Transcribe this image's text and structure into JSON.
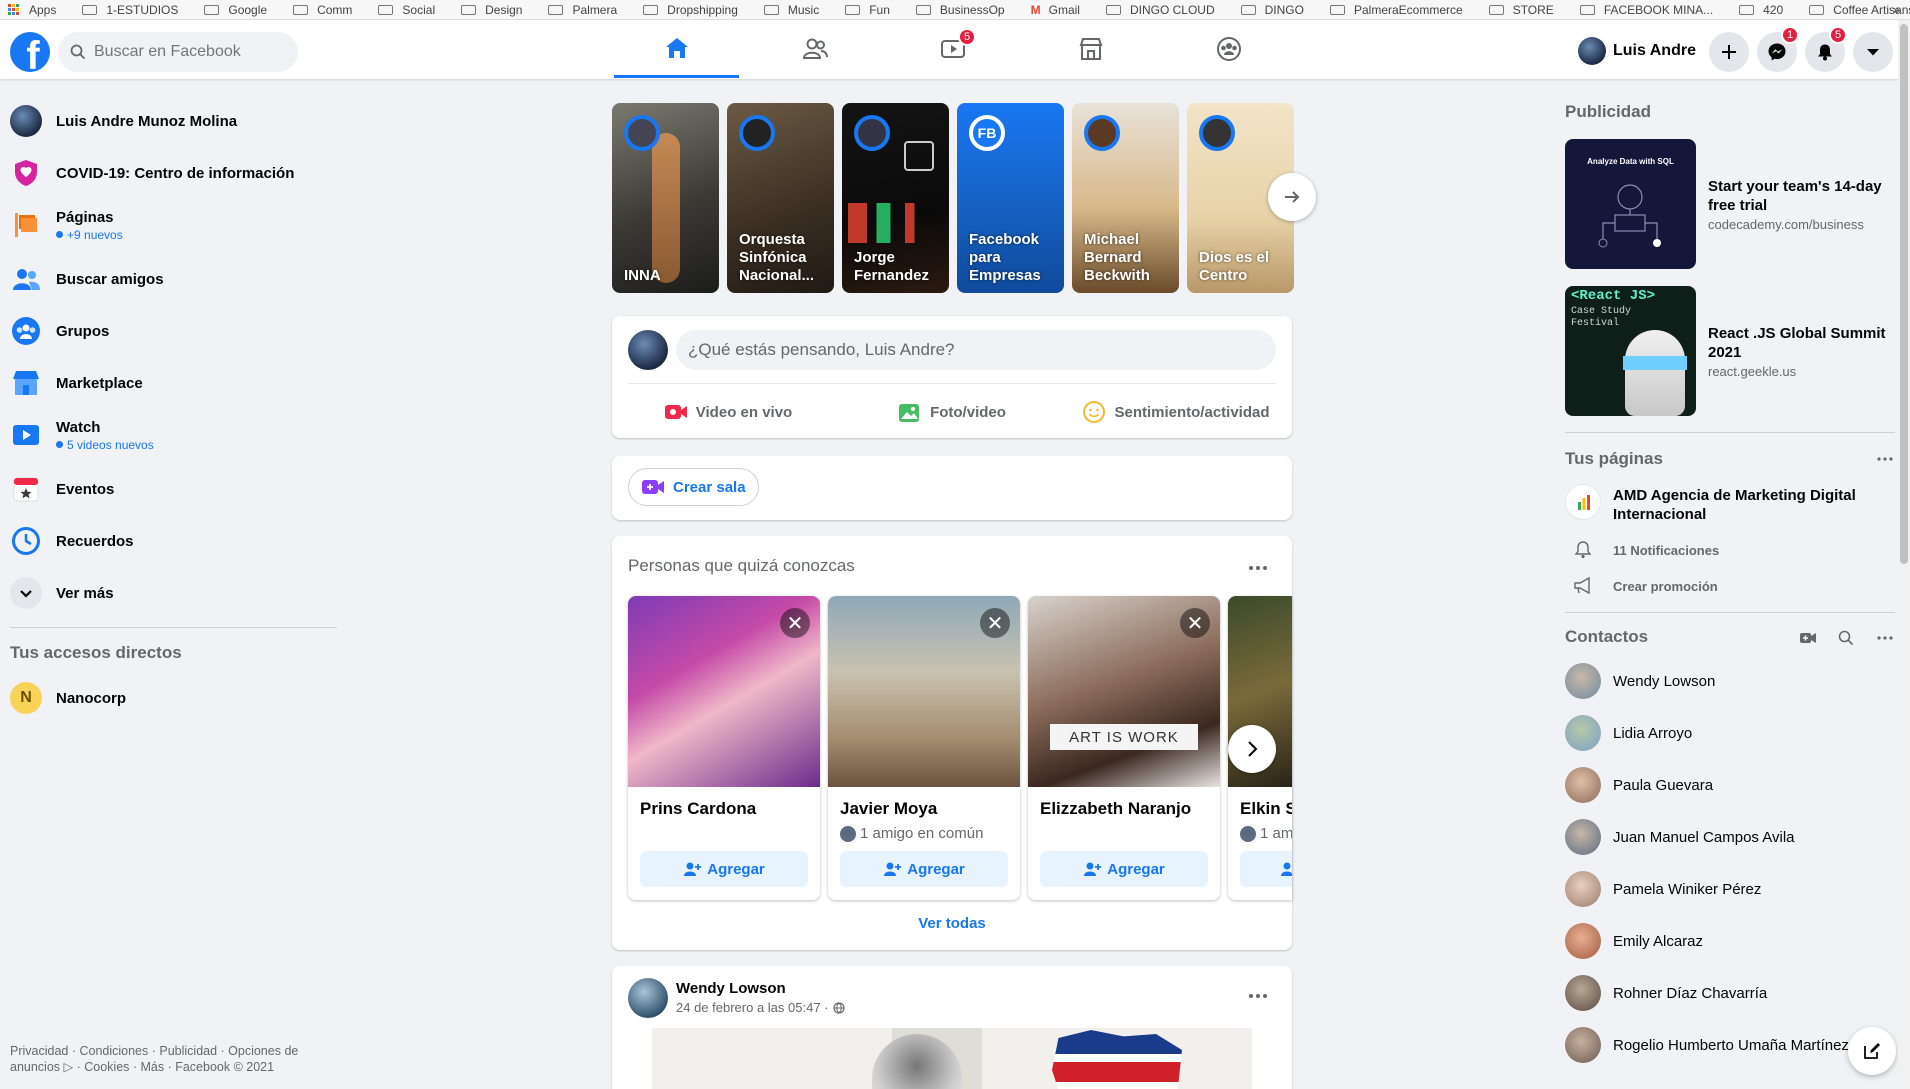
{
  "bookmarks": [
    "Apps",
    "1-ESTUDIOS",
    "Google",
    "Comm",
    "Social",
    "Design",
    "Palmera",
    "Dropshipping",
    "Music",
    "Fun",
    "BusinessOp",
    "Gmail",
    "DINGO CLOUD",
    "DINGO",
    "PalmeraEcommerce",
    "STORE",
    "FACEBOOK MINA...",
    "420",
    "Coffee Artisans"
  ],
  "bookmarks_more": "»",
  "search": {
    "placeholder": "Buscar en Facebook"
  },
  "nav": {
    "watch_badge": "5"
  },
  "profile": {
    "name": "Luis Andre"
  },
  "header_badges": {
    "messenger": "1",
    "notifications": "5"
  },
  "sidebar": {
    "items": [
      {
        "label": "Luis Andre Munoz Molina"
      },
      {
        "label": "COVID-19: Centro de información"
      },
      {
        "label": "Páginas",
        "sub": "+9 nuevos"
      },
      {
        "label": "Buscar amigos"
      },
      {
        "label": "Grupos"
      },
      {
        "label": "Marketplace"
      },
      {
        "label": "Watch",
        "sub": "5 videos nuevos"
      },
      {
        "label": "Eventos"
      },
      {
        "label": "Recuerdos"
      },
      {
        "label": "Ver más"
      }
    ],
    "shortcuts_title": "Tus accesos directos",
    "shortcut": {
      "letter": "N",
      "label": "Nanocorp"
    },
    "footer": "Privacidad · Condiciones · Publicidad · Opciones de anuncios ▷ · Cookies · Más · Facebook © 2021"
  },
  "stories": [
    {
      "name": "INNA",
      "avatar_text": ""
    },
    {
      "name": "Orquesta Sinfónica Nacional...",
      "avatar_text": ""
    },
    {
      "name": "Jorge Fernandez",
      "avatar_text": ""
    },
    {
      "name": "Facebook para Empresas",
      "avatar_text": "FB"
    },
    {
      "name": "Michael Bernard Beckwith",
      "avatar_text": ""
    },
    {
      "name": "Dios es el Centro",
      "avatar_text": ""
    }
  ],
  "composer": {
    "placeholder": "¿Qué estás pensando, Luis Andre?",
    "live": "Video en vivo",
    "photo": "Foto/video",
    "feeling": "Sentimiento/actividad"
  },
  "room": {
    "label": "Crear sala"
  },
  "pymk": {
    "title": "Personas que quizá conozcas",
    "people": [
      {
        "name": "Prins Cardona",
        "mutual": "",
        "add": "Agregar"
      },
      {
        "name": "Javier Moya",
        "mutual": "1 amigo en común",
        "add": "Agregar"
      },
      {
        "name": "Elizzabeth Naranjo",
        "mutual": "",
        "add": "Agregar",
        "overlay": "ART IS WORK"
      },
      {
        "name": "Elkin S",
        "mutual": "1 am",
        "add": "Agregar"
      }
    ],
    "see_all": "Ver todas"
  },
  "post": {
    "author": "Wendy Lowson",
    "time": "24 de febrero a las 05:47 ·"
  },
  "ads": {
    "title": "Publicidad",
    "items": [
      {
        "headline": "Start your team's 14-day free trial",
        "domain": "codecademy.com/business",
        "image_text": "Analyze Data with SQL"
      },
      {
        "headline": "React .JS Global Summit 2021",
        "domain": "react.geekle.us",
        "image_text": "<React JS>",
        "image_sub": "Case Study Festival"
      }
    ]
  },
  "pages": {
    "title": "Tus páginas",
    "page_name": "AMD Agencia de Marketing Digital Internacional",
    "notifications": "11 Notificaciones",
    "promo": "Crear promoción"
  },
  "contacts": {
    "title": "Contactos",
    "people": [
      "Wendy Lowson",
      "Lidia Arroyo",
      "Paula Guevara",
      "Juan Manuel Campos Avila",
      "Pamela Winiker Pérez",
      "Emily Alcaraz",
      "Rohner Díaz Chavarría",
      "Rogelio Humberto Umaña Martínez"
    ]
  },
  "colors": {
    "brand": "#1877f2",
    "badge": "#e41e3f",
    "bg": "#f0f2f5"
  }
}
